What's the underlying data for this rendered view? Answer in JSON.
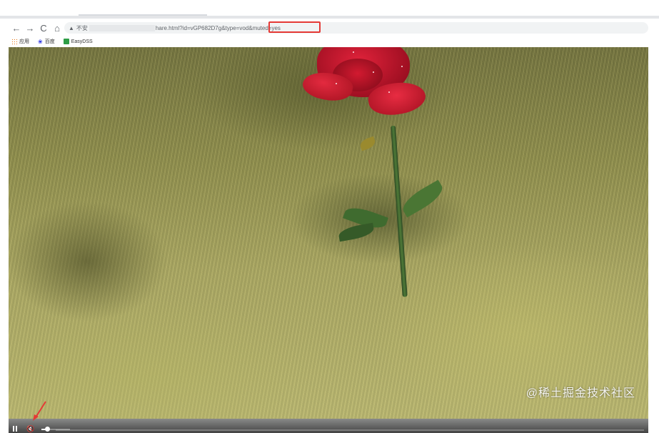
{
  "browser": {
    "nav": {
      "back_icon": "←",
      "forward_icon": "→",
      "reload_icon": "C",
      "home_icon": "⌂"
    },
    "address": {
      "warning_icon": "▲",
      "security_label": "不安",
      "url_visible": "hare.html?id=vGP682D7g&type=vod",
      "url_highlight": "&muted=yes"
    },
    "bookmarks": [
      {
        "label": "应用",
        "icon": "apps-grid-icon"
      },
      {
        "label": "百度",
        "icon": "baidu-paw-icon"
      },
      {
        "label": "EasyDSS",
        "icon": "easydss-icon"
      }
    ]
  },
  "player": {
    "content": "red rose on grassland video frame",
    "muted_icon": "🔇",
    "volume_level": 0.2
  },
  "watermark": "@稀土掘金技术社区",
  "colors": {
    "highlight_box": "#e53935",
    "annotation_arrow": "#e53935",
    "rose": "#c8162e"
  }
}
